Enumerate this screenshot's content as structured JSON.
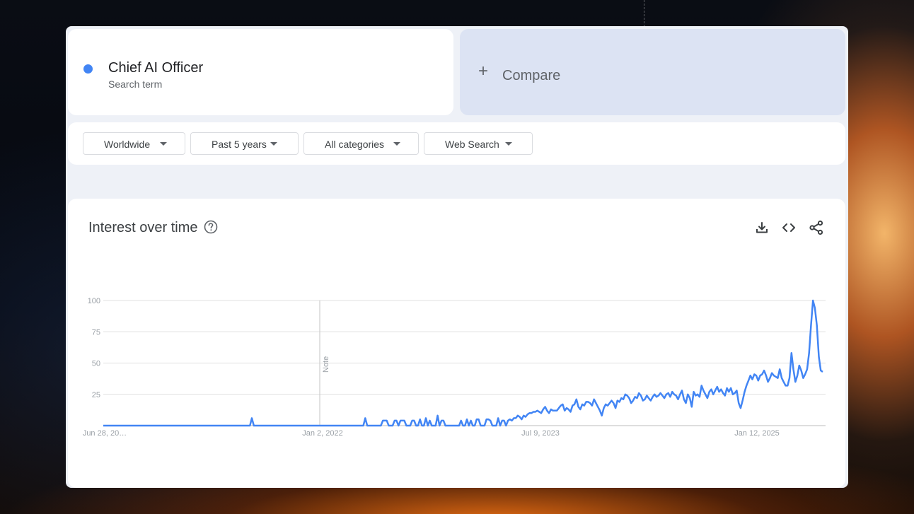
{
  "search_term": {
    "name": "Chief AI Officer",
    "subtitle": "Search term",
    "color": "#4285f4"
  },
  "compare": {
    "label": "Compare",
    "icon": "plus-icon"
  },
  "filters": [
    {
      "label": "Worldwide"
    },
    {
      "label": "Past 5 years"
    },
    {
      "label": "All categories"
    },
    {
      "label": "Web Search"
    }
  ],
  "chart_card": {
    "title": "Interest over time",
    "icons": [
      "help-icon",
      "download-icon",
      "embed-icon",
      "share-icon"
    ]
  },
  "chart_data": {
    "type": "line",
    "title": "Interest over time",
    "xlabel": "",
    "ylabel": "",
    "ylim": [
      0,
      100
    ],
    "yticks": [
      25,
      50,
      75,
      100
    ],
    "xtick_labels": [
      "Jun 28, 20…",
      "Jan 2, 2022",
      "Jul 9, 2023",
      "Jan 12, 2025"
    ],
    "note_label": "Note",
    "grid": true,
    "line_color": "#4285f4",
    "series": [
      {
        "name": "Chief AI Officer",
        "values": [
          0,
          0,
          0,
          0,
          0,
          0,
          0,
          0,
          0,
          0,
          0,
          0,
          0,
          0,
          0,
          0,
          0,
          0,
          0,
          0,
          0,
          0,
          0,
          0,
          0,
          0,
          0,
          0,
          0,
          0,
          0,
          0,
          0,
          0,
          0,
          0,
          0,
          0,
          0,
          0,
          0,
          0,
          0,
          0,
          0,
          0,
          0,
          0,
          0,
          0,
          0,
          0,
          0,
          0,
          0,
          0,
          0,
          0,
          0,
          0,
          0,
          0,
          0,
          0,
          0,
          0,
          0,
          0,
          0,
          0,
          0,
          0,
          0,
          0,
          0,
          0,
          6,
          0,
          0,
          0,
          0,
          0,
          0,
          0,
          0,
          0,
          0,
          0,
          0,
          0,
          0,
          0,
          0,
          0,
          0,
          0,
          0,
          0,
          0,
          0,
          0,
          0,
          0,
          0,
          0,
          0,
          0,
          0,
          0,
          0,
          0,
          0,
          0,
          0,
          0,
          0,
          0,
          0,
          0,
          0,
          0,
          0,
          0,
          0,
          0,
          0,
          0,
          0,
          0,
          0,
          0,
          0,
          0,
          0,
          6,
          0,
          0,
          0,
          0,
          0,
          0,
          0,
          0,
          4,
          4,
          4,
          0,
          0,
          0,
          4,
          4,
          0,
          4,
          4,
          4,
          0,
          0,
          0,
          4,
          4,
          0,
          0,
          5,
          0,
          0,
          6,
          0,
          4,
          0,
          0,
          0,
          8,
          0,
          4,
          4,
          0,
          0,
          0,
          0,
          0,
          0,
          0,
          0,
          4,
          0,
          0,
          5,
          0,
          4,
          0,
          0,
          5,
          5,
          0,
          0,
          0,
          5,
          5,
          4,
          0,
          0,
          0,
          6,
          0,
          4,
          4,
          0,
          4,
          5,
          4,
          6,
          6,
          8,
          7,
          5,
          8,
          7,
          9,
          10,
          10,
          11,
          11,
          12,
          11,
          10,
          13,
          15,
          12,
          10,
          13,
          12,
          12,
          12,
          14,
          16,
          17,
          12,
          14,
          13,
          11,
          16,
          17,
          21,
          15,
          13,
          17,
          16,
          19,
          19,
          18,
          16,
          21,
          18,
          15,
          12,
          8,
          14,
          17,
          16,
          18,
          20,
          18,
          14,
          20,
          19,
          22,
          21,
          25,
          24,
          22,
          18,
          20,
          23,
          22,
          26,
          24,
          20,
          21,
          24,
          22,
          20,
          23,
          25,
          23,
          24,
          26,
          24,
          22,
          25,
          26,
          23,
          27,
          25,
          24,
          21,
          25,
          28,
          21,
          18,
          25,
          22,
          15,
          27,
          24,
          25,
          23,
          32,
          28,
          25,
          22,
          27,
          29,
          25,
          28,
          31,
          27,
          29,
          26,
          24,
          30,
          27,
          30,
          25,
          26,
          28,
          18,
          14,
          20,
          27,
          32,
          36,
          40,
          37,
          41,
          40,
          36,
          40,
          41,
          44,
          40,
          35,
          38,
          42,
          40,
          39,
          38,
          45,
          38,
          35,
          32,
          32,
          38,
          58,
          45,
          35,
          40,
          48,
          44,
          38,
          41,
          45,
          58,
          80,
          100,
          94,
          80,
          55,
          44,
          43
        ]
      }
    ]
  }
}
